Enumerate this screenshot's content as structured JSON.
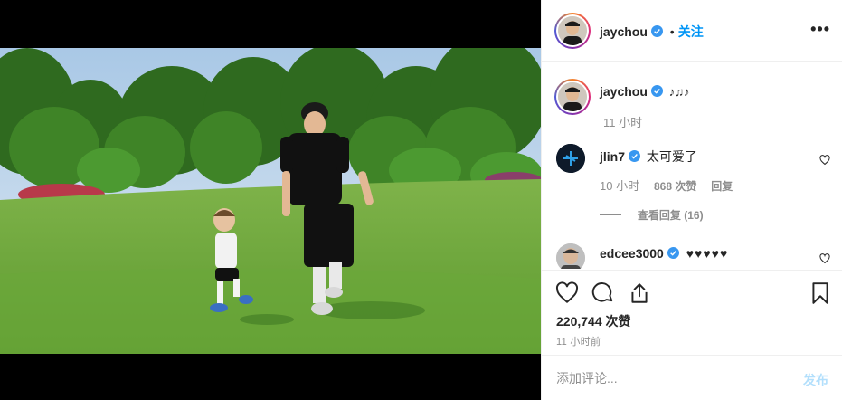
{
  "post": {
    "username": "jaychou",
    "follow_label": "关注",
    "separator": "•",
    "more_icon": "more-horizontal-icon",
    "caption_text": "♪♫♪",
    "caption_time": "11 小时"
  },
  "comments": [
    {
      "username": "jlin7",
      "text": "太可爱了",
      "time": "10 小时",
      "likes": "868 次赞",
      "reply_label": "回复",
      "view_replies": "查看回复 (16)"
    },
    {
      "username": "edcee3000",
      "text": "♥♥♥♥♥"
    }
  ],
  "actions": {
    "like_icon": "heart-icon",
    "comment_icon": "comment-icon",
    "share_icon": "share-icon",
    "save_icon": "bookmark-icon",
    "likes_count": "220,744 次赞",
    "timestamp": "11 小时前"
  },
  "add_comment": {
    "placeholder": "添加评论...",
    "post_label": "发布"
  },
  "colors": {
    "link_blue": "#0095f6",
    "post_disabled": "#b2dffc",
    "verified_blue": "#3897f0"
  }
}
